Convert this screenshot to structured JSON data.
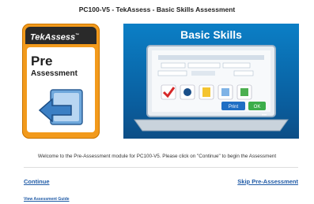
{
  "header": {
    "title": "PC100-V5 - TekAssess - Basic Skills Assessment"
  },
  "badge": {
    "brand": "TekAssess",
    "trademark": "™",
    "line1": "Pre",
    "line2": "Assessment",
    "icon": "arrow-back-document-icon"
  },
  "hero": {
    "title": "Basic Skills",
    "print_button": "Print",
    "ok_button": "OK",
    "more": "•••",
    "colors": {
      "background": "#0a6bb0",
      "accent": "#f29a1c"
    }
  },
  "welcome_text": "Welcome to the Pre-Assessment module for PC100-V5. Please click on \"Continue\" to begin the Assessment",
  "actions": {
    "continue": "Continue",
    "skip": "Skip Pre-Assessment",
    "guide": "View Assessment Guide"
  }
}
